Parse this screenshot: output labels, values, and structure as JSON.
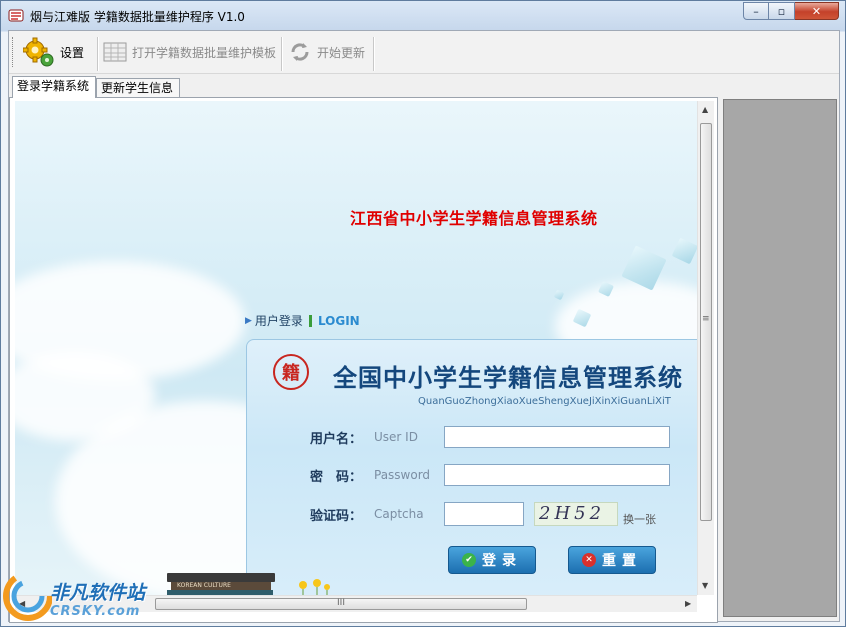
{
  "window": {
    "title": "烟与江难版 学籍数据批量维护程序 V1.0",
    "controls": {
      "minimize": "–",
      "maximize": "▫",
      "close": "✕"
    }
  },
  "toolbar": {
    "settings_label": "设置",
    "open_template_label": "打开学籍数据批量维护模板",
    "start_update_label": "开始更新"
  },
  "tabs": [
    {
      "label": "登录学籍系统",
      "active": true
    },
    {
      "label": "更新学生信息",
      "active": false
    }
  ],
  "page": {
    "system_title": "江西省中小学生学籍信息管理系统",
    "login_caption_cn": "用户登录",
    "login_caption_en": "LOGIN",
    "panel_title": "全国中小学生学籍信息管理系统",
    "panel_pinyin": "QuanGuoZhongXiaoXueShengXueJiXinXiGuanLiXiT",
    "emblem_glyph": "籍",
    "fields": {
      "username": {
        "label": "用户名：",
        "hint": "User ID",
        "value": ""
      },
      "password": {
        "label": "密　码：",
        "hint": "Password",
        "value": ""
      },
      "captcha": {
        "label": "验证码：",
        "hint": "Captcha",
        "value": "",
        "image_text": "2H52",
        "refresh_label": "换一张"
      }
    },
    "login_button": "登录",
    "reset_button": "重置",
    "books_text": "KOREAN CULTURE"
  },
  "scrollbars": {
    "h_grip": "III",
    "v_grip": "≡"
  },
  "watermark": {
    "cn": "非凡软件站",
    "en": "CRSKY.com"
  },
  "colors": {
    "system_title": "#e00000",
    "panel_title": "#14477d",
    "button_blue": "#1c6fb0",
    "right_pane": "#a7a7a7"
  }
}
